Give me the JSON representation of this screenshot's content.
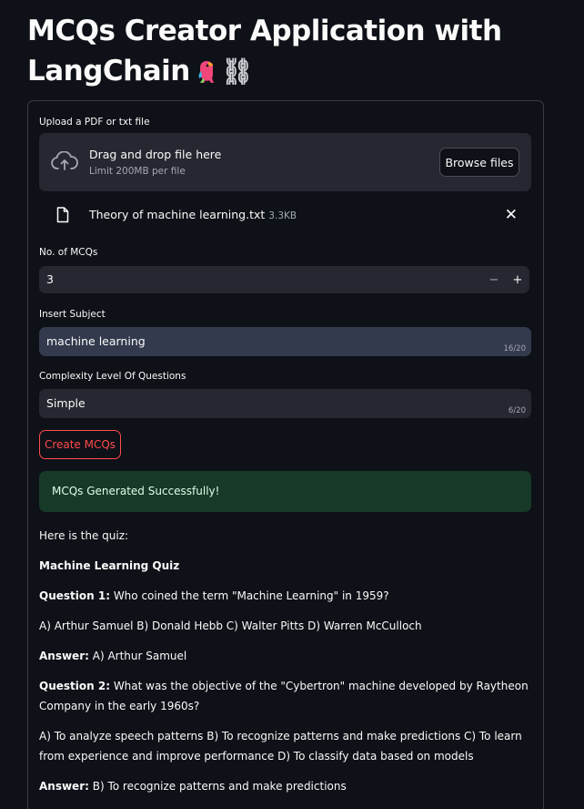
{
  "app": {
    "title": "MCQs Creator Application with LangChain",
    "title_emoji_parrot": "parrot",
    "title_emoji_chain": "⛓"
  },
  "uploader": {
    "label": "Upload a PDF or txt file",
    "drag_text": "Drag and drop file here",
    "limit_text": "Limit 200MB per file",
    "browse_label": "Browse files",
    "file_name": "Theory of machine learning.txt",
    "file_size": "3.3KB"
  },
  "num_mcqs": {
    "label": "No. of MCQs",
    "value": "3",
    "minus": "−",
    "plus": "+"
  },
  "subject": {
    "label": "Insert Subject",
    "value": "machine learning",
    "count": "16/20"
  },
  "complexity": {
    "label": "Complexity Level Of Questions",
    "value": "Simple",
    "count": "6/20"
  },
  "create_button": "Create MCQs",
  "success_message": "MCQs Generated Successfully!",
  "quiz": {
    "intro": "Here is the quiz:",
    "title": "Machine Learning Quiz",
    "q1_label": "Question 1:",
    "q1_text": " Who coined the term \"Machine Learning\" in 1959?",
    "q1_options": "A) Arthur Samuel B) Donald Hebb C) Walter Pitts D) Warren McCulloch",
    "a1_label": "Answer:",
    "a1_text": " A) Arthur Samuel",
    "q2_label": "Question 2:",
    "q2_text": " What was the objective of the \"Cybertron\" machine developed by Raytheon Company in the early 1960s?",
    "q2_options": "A) To analyze speech patterns B) To recognize patterns and make predictions C) To learn from experience and improve performance D) To classify data based on models",
    "a2_label": "Answer:",
    "a2_text": " B) To recognize patterns and make predictions"
  },
  "icons": {
    "upload": "cloud-upload-icon",
    "file": "file-icon",
    "close": "close-icon"
  },
  "colors": {
    "background": "#0e1117",
    "input_bg": "#262730",
    "accent": "#ff4b4b",
    "success_bg": "#173928"
  }
}
